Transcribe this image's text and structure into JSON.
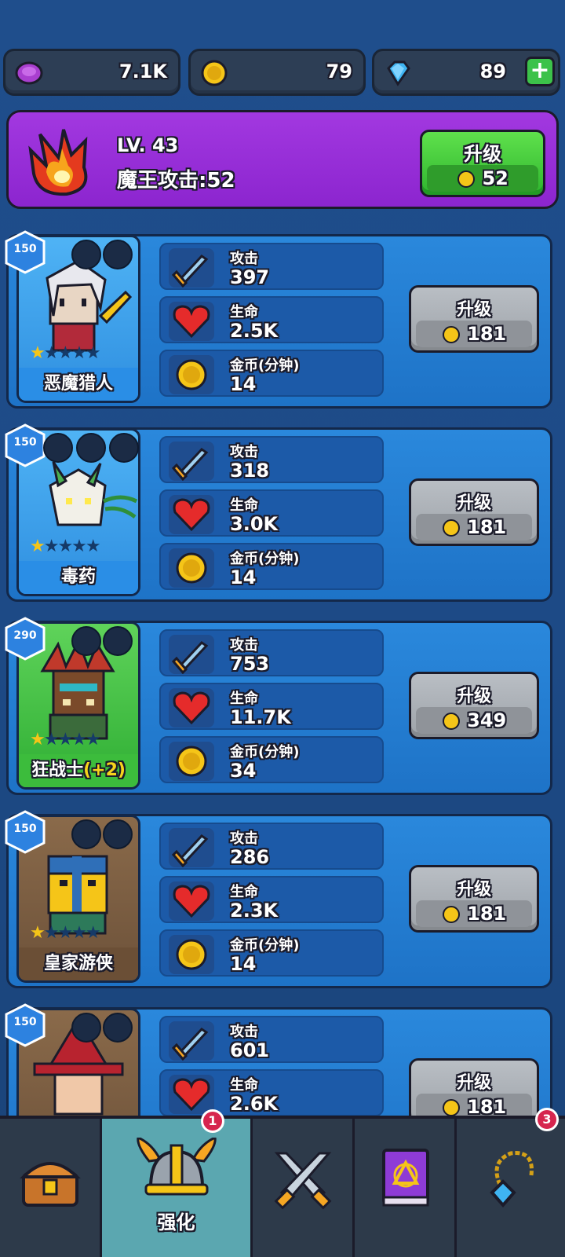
{
  "currencies": {
    "gems_purple": "7.1K",
    "coins": "79",
    "diamonds": "89"
  },
  "demon_king": {
    "level": "LV. 43",
    "attack": "魔王攻击:52",
    "upgrade_label": "升级",
    "upgrade_cost": "52"
  },
  "stat_labels": {
    "attack": "攻击",
    "hp": "生命",
    "gold": "金币(分钟)"
  },
  "heroes": [
    {
      "level": "150",
      "name": "恶魔猎人",
      "stars": 1,
      "attack": "397",
      "hp": "2.5K",
      "gold": "14",
      "upgrade_label": "升级",
      "cost": "181"
    },
    {
      "level": "150",
      "name": "毒药",
      "stars": 1,
      "attack": "318",
      "hp": "3.0K",
      "gold": "14",
      "upgrade_label": "升级",
      "cost": "181"
    },
    {
      "level": "290",
      "name": "狂战士",
      "bonus": "(+2)",
      "stars": 1,
      "attack": "753",
      "hp": "11.7K",
      "gold": "34",
      "upgrade_label": "升级",
      "cost": "349"
    },
    {
      "level": "150",
      "name": "皇家游侠",
      "stars": 1,
      "attack": "286",
      "hp": "2.3K",
      "gold": "14",
      "upgrade_label": "升级",
      "cost": "181"
    },
    {
      "level": "150",
      "name": "",
      "stars": 1,
      "attack": "601",
      "hp": "2.6K",
      "gold": "",
      "upgrade_label": "升级",
      "cost": "181"
    }
  ],
  "nav": {
    "active_label": "强化",
    "upgrade_badge": "1",
    "items_badge": "3"
  }
}
